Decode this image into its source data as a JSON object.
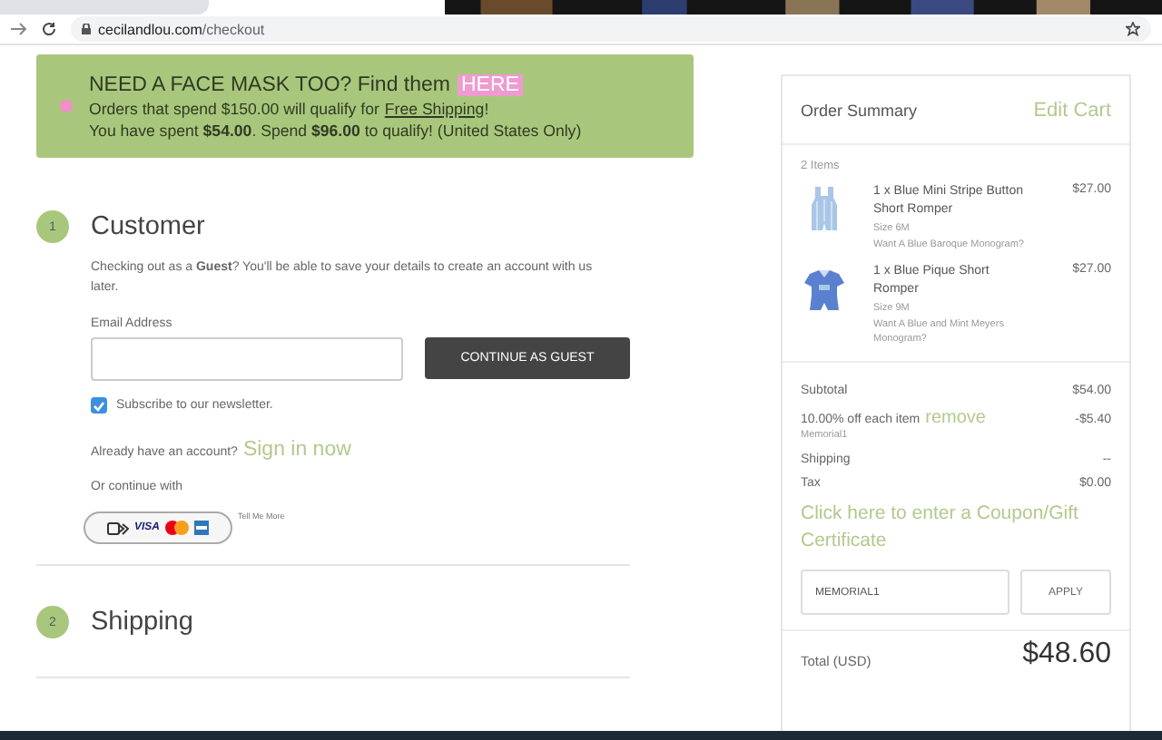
{
  "browser": {
    "url_domain": "cecilandlou.com",
    "url_path": "/checkout"
  },
  "banner": {
    "heading": "NEED A FACE MASK TOO? Find them",
    "heading_link": "HERE",
    "line_1": "Orders that spend $150.00 will qualify for",
    "line_1_link": "Free Shipping",
    "line_1_end": "!",
    "line_2": "You have spent **$54.00**. Spend **$96.00** to qualify! (United States Only)"
  },
  "customer": {
    "step": "1",
    "title": "Customer",
    "intro": "Checking out as a **Guest**? You'll be able to save your details to create an account with us later.",
    "email_label": "Email Address",
    "continue_button": "CONTINUE AS GUEST",
    "newsletter": {
      "label": "Subscribe to our newsletter.",
      "checked": true
    },
    "account_prompt": "Already have an account?",
    "sign_in_link": "Sign in now",
    "or_continue": "Or continue with",
    "card_brand": "VISA",
    "tell_me_more": "Tell Me More"
  },
  "shipping": {
    "step": "2",
    "title": "Shipping"
  },
  "summary": {
    "title": "Order Summary",
    "edit_link": "Edit Cart",
    "item_count": "2 Items",
    "items": [
      {
        "title": "1 x Blue Mini Stripe Button Short Romper",
        "size": "Size 6M",
        "option": "Want A Blue Baroque Monogram?",
        "price": "$27.00",
        "kind": "stripe"
      },
      {
        "title": "1 x Blue Pique Short Romper",
        "size": "Size 9M",
        "option": "Want A Blue and Mint Meyers Monogram?",
        "price": "$27.00",
        "kind": "pique"
      }
    ],
    "subtotal_label": "Subtotal",
    "subtotal": "$54.00",
    "discount_label": "10.00% off each item",
    "remove_link": "remove",
    "discount": "-$5.40",
    "discount_code": "Memorial1",
    "shipping_label": "Shipping",
    "shipping": "--",
    "tax_label": "Tax",
    "tax": "$0.00",
    "coupon_link": "Click here to enter a Coupon/Gift Certificate",
    "coupon_value": "MEMORIAL1",
    "apply_button": "APPLY",
    "total_label": "Total (USD)",
    "total": "$48.60"
  }
}
